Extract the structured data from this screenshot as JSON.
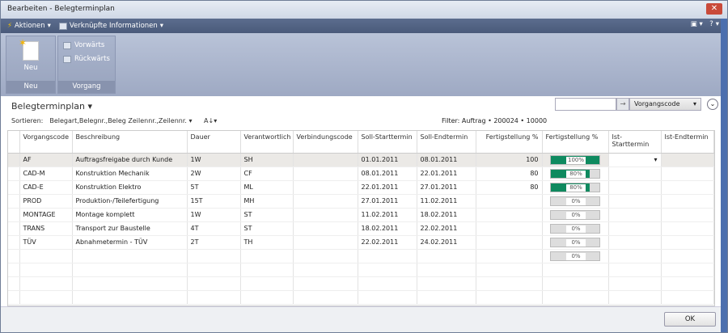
{
  "window": {
    "title": "Bearbeiten - Belegterminplan",
    "close": "✕"
  },
  "toolbar": {
    "actions": "Aktionen",
    "linked": "Verknüpfte Informationen",
    "help": "?"
  },
  "ribbon": {
    "new_label": "Neu",
    "group_new": "Neu",
    "forward": "Vorwärts",
    "backward": "Rückwärts",
    "group_process": "Vorgang"
  },
  "page": {
    "title": "Belegterminplan",
    "sort_label": "Sortieren:",
    "sort_value": "Belegart,Belegnr.,Beleg Zeilennr.,Zeilennr.",
    "filter": "Filter: Auftrag • 200024 • 10000",
    "search_value": "",
    "search_field": "Vorgangscode"
  },
  "columns": [
    "Vorgangscode",
    "Beschreibung",
    "Dauer",
    "Verantwortlich",
    "Verbindungscode",
    "Soll-Starttermin",
    "Soll-Endtermin",
    "Fertigstellung %",
    "Fertigstellung %",
    "Ist-Starttermin",
    "Ist-Endtermin"
  ],
  "rows": [
    {
      "code": "AF",
      "desc": "Auftragsfreigabe durch Kunde",
      "dur": "1W",
      "resp": "SH",
      "link": "",
      "start": "01.01.2011",
      "end": "08.01.2011",
      "pct": "100",
      "bar": 100,
      "bar_label": "100%"
    },
    {
      "code": "CAD-M",
      "desc": "Konstruktion Mechanik",
      "dur": "2W",
      "resp": "CF",
      "link": "",
      "start": "08.01.2011",
      "end": "22.01.2011",
      "pct": "80",
      "bar": 80,
      "bar_label": "80%"
    },
    {
      "code": "CAD-E",
      "desc": "Konstruktion Elektro",
      "dur": "5T",
      "resp": "ML",
      "link": "",
      "start": "22.01.2011",
      "end": "27.01.2011",
      "pct": "80",
      "bar": 80,
      "bar_label": "80%"
    },
    {
      "code": "PROD",
      "desc": "Produktion-/Teilefertigung",
      "dur": "15T",
      "resp": "MH",
      "link": "",
      "start": "27.01.2011",
      "end": "11.02.2011",
      "pct": "",
      "bar": 0,
      "bar_label": "0%"
    },
    {
      "code": "MONTAGE",
      "desc": "Montage komplett",
      "dur": "1W",
      "resp": "ST",
      "link": "",
      "start": "11.02.2011",
      "end": "18.02.2011",
      "pct": "",
      "bar": 0,
      "bar_label": "0%"
    },
    {
      "code": "TRANS",
      "desc": "Transport zur Baustelle",
      "dur": "4T",
      "resp": "ST",
      "link": "",
      "start": "18.02.2011",
      "end": "22.02.2011",
      "pct": "",
      "bar": 0,
      "bar_label": "0%"
    },
    {
      "code": "TÜV",
      "desc": "Abnahmetermin - TÜV",
      "dur": "2T",
      "resp": "TH",
      "link": "",
      "start": "22.02.2011",
      "end": "24.02.2011",
      "pct": "",
      "bar": 0,
      "bar_label": "0%"
    },
    {
      "code": "",
      "desc": "",
      "dur": "",
      "resp": "",
      "link": "",
      "start": "",
      "end": "",
      "pct": "",
      "bar": 0,
      "bar_label": "0%"
    }
  ],
  "footer": {
    "ok": "OK"
  },
  "colors": {
    "progress": "#0f8a5f",
    "toolbar": "#4a5a7a"
  }
}
